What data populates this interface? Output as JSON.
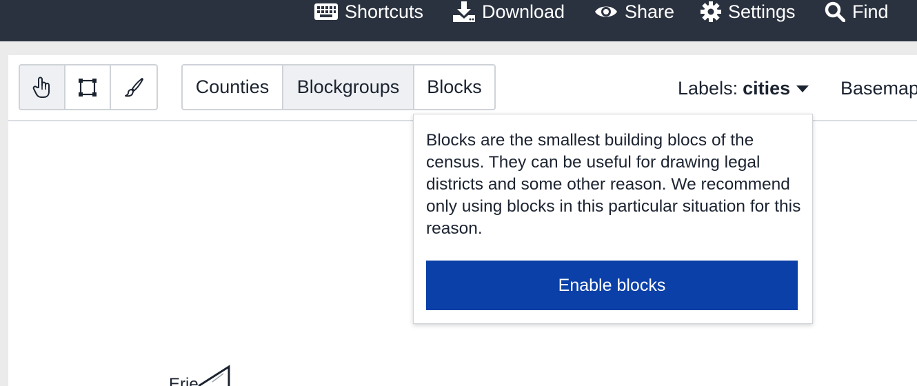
{
  "topbar": {
    "items": [
      {
        "label": "Shortcuts",
        "icon": "keyboard-icon"
      },
      {
        "label": "Download",
        "icon": "download-icon"
      },
      {
        "label": "Share",
        "icon": "eye-icon"
      },
      {
        "label": "Settings",
        "icon": "gear-icon"
      },
      {
        "label": "Find",
        "icon": "search-icon"
      }
    ]
  },
  "toolbar": {
    "tools": [
      {
        "name": "pan",
        "icon": "hand-pointer-icon",
        "active": true
      },
      {
        "name": "select-rectangle",
        "icon": "rectangle-select-icon",
        "active": false
      },
      {
        "name": "brush",
        "icon": "paintbrush-icon",
        "active": false
      }
    ],
    "units": [
      {
        "label": "Counties",
        "active": false
      },
      {
        "label": "Blockgroups",
        "active": true
      },
      {
        "label": "Blocks",
        "active": false
      }
    ],
    "labels_prefix": "Labels:",
    "labels_value": "cities",
    "basemap_label": "Basemap"
  },
  "popover": {
    "text": "Blocks are the smallest building blocs of the census. They can be useful for drawing legal districts and some other reason. We recommend only using blocks in this particular situation for this reason.",
    "button_label": "Enable blocks"
  },
  "map": {
    "label_fragment": "Erie"
  },
  "colors": {
    "topbar_bg": "#2b323f",
    "primary_button": "#0a40a8",
    "page_bg": "#ebebeb",
    "text": "#1c2330"
  }
}
